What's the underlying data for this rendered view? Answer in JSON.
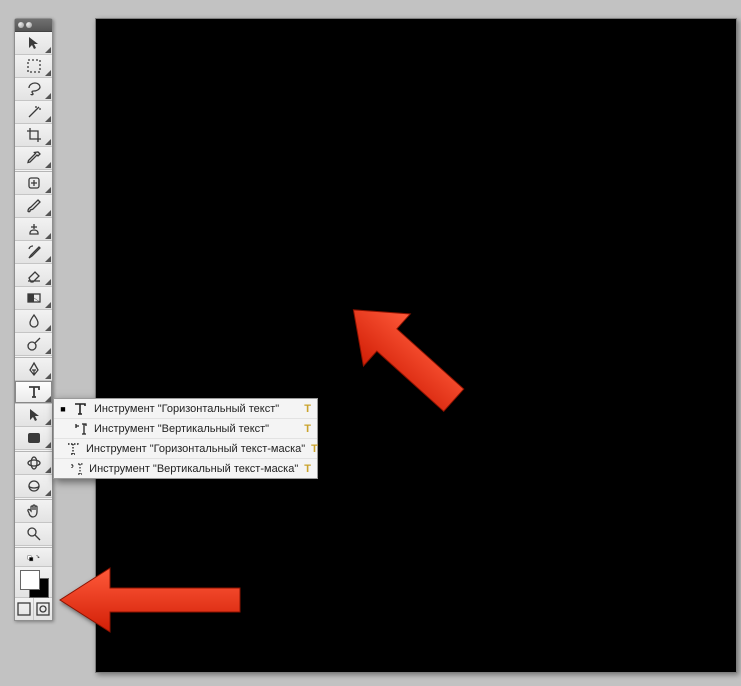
{
  "tools": {
    "move": "move-tool",
    "marquee": "marquee-tool",
    "lasso": "lasso-tool",
    "wand": "magic-wand-tool",
    "crop": "crop-tool",
    "eyedropper": "eyedropper-tool",
    "healing": "healing-brush-tool",
    "brush": "brush-tool",
    "clone": "clone-stamp-tool",
    "history": "history-brush-tool",
    "eraser": "eraser-tool",
    "gradient": "gradient-tool",
    "blur": "blur-tool",
    "dodge": "dodge-tool",
    "pen": "pen-tool",
    "type": "type-tool",
    "path": "path-selection-tool",
    "shape": "shape-tool",
    "notes": "notes-tool",
    "hand": "hand-tool",
    "zoom": "zoom-tool",
    "swap": "swap-colors",
    "default": "default-colors",
    "fg": "foreground-color",
    "bg": "background-color",
    "std": "standard-mode",
    "qmask": "quick-mask-mode"
  },
  "flyout": {
    "shortcut": "T",
    "items": [
      {
        "label": "Инструмент \"Горизонтальный текст\"",
        "selected": true,
        "icon": "t-horiz"
      },
      {
        "label": "Инструмент \"Вертикальный текст\"",
        "selected": false,
        "icon": "t-vert"
      },
      {
        "label": "Инструмент \"Горизонтальный текст-маска\"",
        "selected": false,
        "icon": "t-horiz-mask"
      },
      {
        "label": "Инструмент \"Вертикальный текст-маска\"",
        "selected": false,
        "icon": "t-vert-mask"
      }
    ]
  },
  "colors": {
    "arrow": "#e8341c",
    "fg": "#ffffff",
    "bg": "#000000"
  }
}
